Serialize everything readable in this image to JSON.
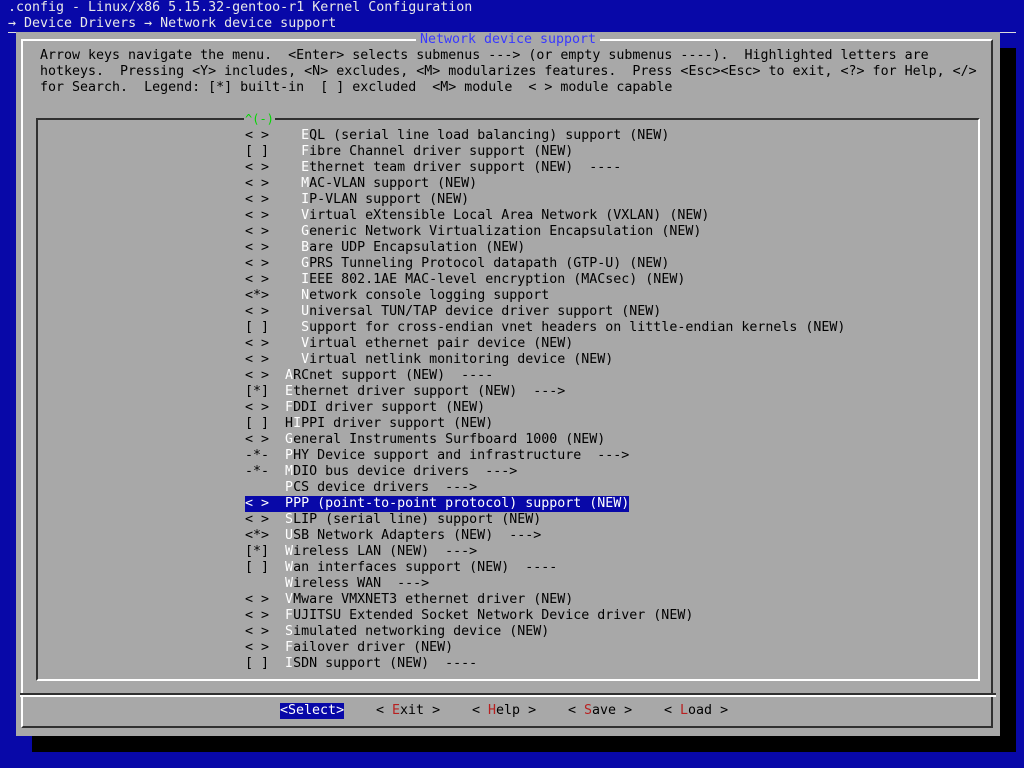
{
  "header": {
    "title": ".config - Linux/x86 5.15.32-gentoo-r1 Kernel Configuration",
    "breadcrumb": "→ Device Drivers → Network device support"
  },
  "dialog": {
    "title": "Network device support",
    "help_lines": [
      "Arrow keys navigate the menu.  <Enter> selects submenus ---> (or empty submenus ----).  Highlighted letters are",
      "hotkeys.  Pressing <Y> includes, <N> excludes, <M> modularizes features.  Press <Esc><Esc> to exit, <?> for Help, </>",
      "for Search.  Legend: [*] built-in  [ ] excluded  <M> module  < > module capable"
    ],
    "scroll_indicator": "^(-)"
  },
  "menu": {
    "items": [
      {
        "state": "< >",
        "indent": 2,
        "hotkey": "E",
        "rest": "QL (serial line load balancing) support (NEW)"
      },
      {
        "state": "[ ]",
        "indent": 2,
        "hotkey": "F",
        "rest": "ibre Channel driver support (NEW)"
      },
      {
        "state": "< >",
        "indent": 2,
        "hotkey": "E",
        "rest": "thernet team driver support (NEW)  ----"
      },
      {
        "state": "< >",
        "indent": 2,
        "hotkey": "M",
        "rest": "AC-VLAN support (NEW)"
      },
      {
        "state": "< >",
        "indent": 2,
        "hotkey": "I",
        "rest": "P-VLAN support (NEW)"
      },
      {
        "state": "< >",
        "indent": 2,
        "hotkey": "V",
        "rest": "irtual eXtensible Local Area Network (VXLAN) (NEW)"
      },
      {
        "state": "< >",
        "indent": 2,
        "hotkey": "G",
        "rest": "eneric Network Virtualization Encapsulation (NEW)"
      },
      {
        "state": "< >",
        "indent": 2,
        "hotkey": "B",
        "rest": "are UDP Encapsulation (NEW)"
      },
      {
        "state": "< >",
        "indent": 2,
        "hotkey": "G",
        "rest": "PRS Tunneling Protocol datapath (GTP-U) (NEW)"
      },
      {
        "state": "< >",
        "indent": 2,
        "hotkey": "I",
        "rest": "EEE 802.1AE MAC-level encryption (MACsec) (NEW)"
      },
      {
        "state": "<*>",
        "indent": 2,
        "hotkey": "N",
        "rest": "etwork console logging support"
      },
      {
        "state": "< >",
        "indent": 2,
        "hotkey": "U",
        "rest": "niversal TUN/TAP device driver support (NEW)"
      },
      {
        "state": "[ ]",
        "indent": 2,
        "hotkey": "S",
        "rest": "upport for cross-endian vnet headers on little-endian kernels (NEW)"
      },
      {
        "state": "< >",
        "indent": 2,
        "hotkey": "V",
        "rest": "irtual ethernet pair device (NEW)"
      },
      {
        "state": "< >",
        "indent": 2,
        "hotkey": "V",
        "rest": "irtual netlink monitoring device (NEW)"
      },
      {
        "state": "< >",
        "indent": 0,
        "hotkey": "A",
        "rest": "RCnet support (NEW)  ----"
      },
      {
        "state": "[*]",
        "indent": 0,
        "hotkey": "E",
        "rest": "thernet driver support (NEW)  --->"
      },
      {
        "state": "< >",
        "indent": 0,
        "hotkey": "F",
        "rest": "DDI driver support (NEW)"
      },
      {
        "state": "[ ]",
        "indent": 0,
        "hotkey": "H",
        "rest": "IPPI driver support (NEW)",
        "hk_index": 1
      },
      {
        "state": "< >",
        "indent": 0,
        "hotkey": "G",
        "rest": "eneral Instruments Surfboard 1000 (NEW)"
      },
      {
        "state": "-*-",
        "indent": 0,
        "hotkey": "P",
        "rest": "HY Device support and infrastructure  --->"
      },
      {
        "state": "-*-",
        "indent": 0,
        "hotkey": "M",
        "rest": "DIO bus device drivers  --->"
      },
      {
        "state": "   ",
        "indent": 0,
        "hotkey": "P",
        "rest": "CS device drivers  --->"
      },
      {
        "state": "< >",
        "indent": 0,
        "hotkey": "P",
        "rest": "PP (point-to-point protocol) support (NEW)",
        "selected": true
      },
      {
        "state": "< >",
        "indent": 0,
        "hotkey": "S",
        "rest": "LIP (serial line) support (NEW)"
      },
      {
        "state": "<*>",
        "indent": 0,
        "hotkey": "U",
        "rest": "SB Network Adapters (NEW)  --->"
      },
      {
        "state": "[*]",
        "indent": 0,
        "hotkey": "W",
        "rest": "ireless LAN (NEW)  --->"
      },
      {
        "state": "[ ]",
        "indent": 0,
        "hotkey": "W",
        "rest": "an interfaces support (NEW)  ----"
      },
      {
        "state": "   ",
        "indent": 0,
        "hotkey": "W",
        "rest": "ireless WAN  --->"
      },
      {
        "state": "< >",
        "indent": 0,
        "hotkey": "V",
        "rest": "Mware VMXNET3 ethernet driver (NEW)"
      },
      {
        "state": "< >",
        "indent": 0,
        "hotkey": "F",
        "rest": "UJITSU Extended Socket Network Device driver (NEW)"
      },
      {
        "state": "< >",
        "indent": 0,
        "hotkey": "S",
        "rest": "imulated networking device (NEW)"
      },
      {
        "state": "< >",
        "indent": 0,
        "hotkey": "F",
        "rest": "ailover driver (NEW)"
      },
      {
        "state": "[ ]",
        "indent": 0,
        "hotkey": "I",
        "rest": "SDN support (NEW)  ----"
      }
    ]
  },
  "buttons": {
    "select": {
      "pre": "<",
      "hotkey": "",
      "label": "Select",
      "post": ">"
    },
    "exit": {
      "pre": "< ",
      "hotkey": "E",
      "label": "xit",
      "post": " >"
    },
    "help": {
      "pre": "< ",
      "hotkey": "H",
      "label": "elp",
      "post": " >"
    },
    "save": {
      "pre": "< ",
      "hotkey": "S",
      "label": "ave",
      "post": " >"
    },
    "load": {
      "pre": "< ",
      "hotkey": "L",
      "label": "oad",
      "post": " >"
    }
  },
  "colors": {
    "background": "#0808a8",
    "dialog": "#a8a8a8",
    "hotkey": "#ffffff",
    "button_hotkey": "#b82020",
    "title_text": "#3838ff",
    "scroll_indicator": "#00d800"
  }
}
